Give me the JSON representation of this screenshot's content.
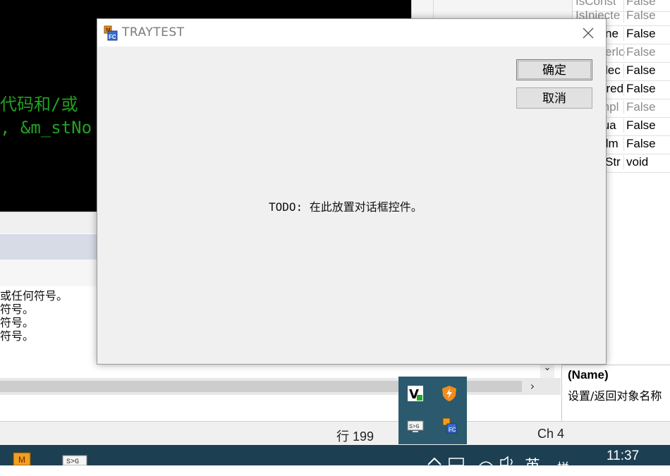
{
  "editor": {
    "lines": [
      "代码和/或",
      ", &m_stNo"
    ]
  },
  "properties": {
    "rows": [
      {
        "name": "IsConst",
        "value": "False",
        "dim": true
      },
      {
        "name": "IsInjecte",
        "value": "False",
        "dim": true
      },
      {
        "name": "ne",
        "value": "False",
        "dim": false
      },
      {
        "name": "erlo",
        "value": "False",
        "dim": true
      },
      {
        "name": "lec",
        "value": "False",
        "dim": false
      },
      {
        "name": "ared",
        "value": "False",
        "dim": false
      },
      {
        "name": "mpl",
        "value": "False",
        "dim": true
      },
      {
        "name": "tua",
        "value": "False",
        "dim": false
      },
      {
        "name": "tlm",
        "value": "False",
        "dim": false
      },
      {
        "name": "Str",
        "value": "void",
        "dim": false
      }
    ],
    "description_title": "(Name)",
    "description_text": "设置/返回对象名称"
  },
  "output": {
    "lines": [
      "或任何符号。",
      "符号。",
      "符号。",
      "符号。"
    ]
  },
  "status": {
    "line": "行 199",
    "ch": "Ch 4"
  },
  "dialog": {
    "title": "TRAYTEST",
    "ok_label": "确定",
    "cancel_label": "取消",
    "placeholder_text": "TODO: 在此放置对话框控件。"
  },
  "taskbar": {
    "clock": "11:37",
    "ime": "英",
    "ime2": "拼"
  },
  "colors": {
    "code_bg": "#000000",
    "code_fg": "#21a121",
    "taskbar_bg": "#1d3f52",
    "tray_popup_bg": "#2b5a6e",
    "dialog_bg": "#f0f0f0"
  }
}
